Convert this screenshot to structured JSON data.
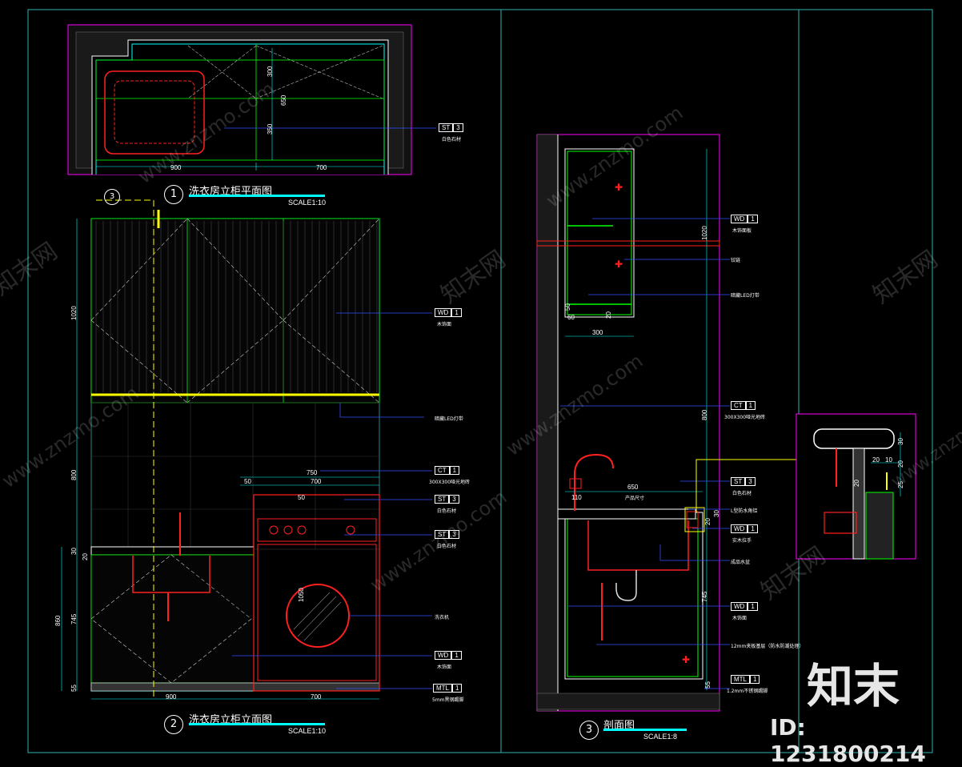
{
  "drawings": {
    "plan": {
      "number": "1",
      "title": "洗衣房立柜平面图",
      "scale": "SCALE1:10"
    },
    "elevation": {
      "number": "2",
      "title": "洗衣房立柜立面图",
      "scale": "SCALE1:10"
    },
    "section": {
      "number": "3",
      "title": "剖面图",
      "scale": "SCALE1:8"
    }
  },
  "section_marker": "3",
  "plan_dims": {
    "w1": "900",
    "w2": "700",
    "d1": "300",
    "d2": "650",
    "d3": "350"
  },
  "plan_tags": [
    {
      "code": "ST",
      "num": "3",
      "note": "白色石材"
    }
  ],
  "elev_dims": {
    "w1": "900",
    "w2": "700",
    "h_top": "1020",
    "h_mid": "800",
    "h_low": "860",
    "h_745": "745",
    "h_55": "55",
    "h_30": "30",
    "h_20": "20",
    "d_750": "750",
    "d_700": "700",
    "d_50a": "50",
    "d_50b": "50",
    "d_1050": "1050"
  },
  "elev_tags": [
    {
      "code": "WD",
      "num": "1",
      "note": "木饰面"
    },
    {
      "code": "",
      "num": "",
      "note": "暗藏LED灯带"
    },
    {
      "code": "CT",
      "num": "1",
      "note": "300X300哑光地砖"
    },
    {
      "code": "ST",
      "num": "3",
      "note": "白色石材"
    },
    {
      "code": "ST",
      "num": "3",
      "note": "白色石材"
    },
    {
      "code": "",
      "num": "",
      "note": "洗衣机"
    },
    {
      "code": "WD",
      "num": "1",
      "note": "木饰面"
    },
    {
      "code": "MTL",
      "num": "1",
      "note": "5mm黑钢踢脚"
    }
  ],
  "section_dims": {
    "h_top": "1020",
    "h_mid": "800",
    "h_low": "745",
    "h_30": "30",
    "h_20": "20",
    "h_55": "55",
    "w_300": "300",
    "w_60": "60",
    "w_50": "50",
    "w_20": "20",
    "w_650": "650",
    "w_110": "110",
    "product": "产品尺寸"
  },
  "section_tags": [
    {
      "code": "WD",
      "num": "1",
      "note": "木饰面板"
    },
    {
      "code": "",
      "num": "",
      "note": "铰链"
    },
    {
      "code": "",
      "num": "",
      "note": "暗藏LED灯带"
    },
    {
      "code": "CT",
      "num": "1",
      "note": "300X300哑光地砖"
    },
    {
      "code": "ST",
      "num": "3",
      "note": "白色石材"
    },
    {
      "code": "",
      "num": "",
      "note": "L型防水角铝"
    },
    {
      "code": "WD",
      "num": "1",
      "note": "实木拉手"
    },
    {
      "code": "",
      "num": "",
      "note": "成品水盆"
    },
    {
      "code": "WD",
      "num": "1",
      "note": "木饰面"
    },
    {
      "code": "",
      "num": "",
      "note": "12mm夹板基层（防水防潮处理）"
    },
    {
      "code": "MTL",
      "num": "1",
      "note": "1.2mm不锈钢踢脚"
    }
  ],
  "detail_dims": {
    "a": "30",
    "b": "20",
    "c": "10",
    "d": "20",
    "e": "25",
    "f": "20"
  },
  "watermark": {
    "cn": "知末网",
    "url": "www.znzmo.com"
  },
  "logo": {
    "text": "知末",
    "id": "ID: 1231800214"
  },
  "colors": {
    "frame": "#2fb3b3",
    "magenta": "#ff00ff",
    "cyan": "#00ffff",
    "green": "#00ff00",
    "red": "#ff2020",
    "yellow": "#ffff00",
    "blue": "#3050ff",
    "white": "#ffffff"
  }
}
